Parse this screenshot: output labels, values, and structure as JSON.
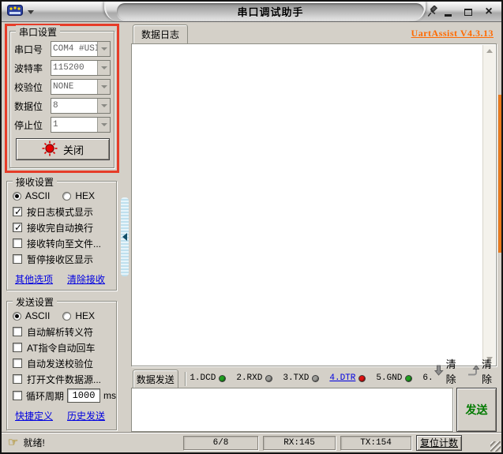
{
  "titlebar": {
    "title": "串口调试助手"
  },
  "serial_settings": {
    "group_title": "串口设置",
    "fields": [
      {
        "label": "串口号",
        "value": "COM4 #USI"
      },
      {
        "label": "波特率",
        "value": "115200"
      },
      {
        "label": "校验位",
        "value": "NONE"
      },
      {
        "label": "数据位",
        "value": "8"
      },
      {
        "label": "停止位",
        "value": "1"
      }
    ],
    "close_button_label": "关闭"
  },
  "receive_settings": {
    "group_title": "接收设置",
    "radio_ascii": {
      "label": "ASCII",
      "checked": true
    },
    "radio_hex": {
      "label": "HEX",
      "checked": false
    },
    "checkboxes": [
      {
        "label": "按日志模式显示",
        "checked": true
      },
      {
        "label": "接收完自动换行",
        "checked": true
      },
      {
        "label": "接收转向至文件...",
        "checked": false
      },
      {
        "label": "暂停接收区显示",
        "checked": false
      }
    ],
    "links": [
      "其他选项",
      "清除接收"
    ]
  },
  "send_settings": {
    "group_title": "发送设置",
    "radio_ascii": {
      "label": "ASCII",
      "checked": true
    },
    "radio_hex": {
      "label": "HEX",
      "checked": false
    },
    "checkboxes": [
      {
        "label": "自动解析转义符",
        "checked": false
      },
      {
        "label": "AT指令自动回车",
        "checked": false
      },
      {
        "label": "自动发送校验位",
        "checked": false
      },
      {
        "label": "打开文件数据源...",
        "checked": false
      }
    ],
    "cycle": {
      "label": "循环周期",
      "checked": false,
      "value": "1000",
      "unit": "ms"
    },
    "links": [
      "快捷定义",
      "历史发送"
    ]
  },
  "log_area": {
    "tab_label": "数据日志",
    "version_link": "UartAssist V4.3.13",
    "content": ""
  },
  "send_area": {
    "tab_label": "数据发送",
    "pins": [
      {
        "label": "1.DCD",
        "color": "#1f9e1f"
      },
      {
        "label": "2.RXD",
        "color": "#9c9c98"
      },
      {
        "label": "3.TXD",
        "color": "#9c9c98"
      },
      {
        "label": "4.DTR",
        "color": "#dd1111"
      },
      {
        "label": "5.GND",
        "color": "#1f9e1f"
      },
      {
        "label": "6."
      }
    ],
    "clear_down_label": "清除",
    "clear_up_label": "清除",
    "send_button_label": "发送",
    "input_value": ""
  },
  "statusbar": {
    "ready": "就绪!",
    "counter": "6/8",
    "rx": "RX:145",
    "tx": "TX:154",
    "reset_button_label": "复位计数"
  }
}
